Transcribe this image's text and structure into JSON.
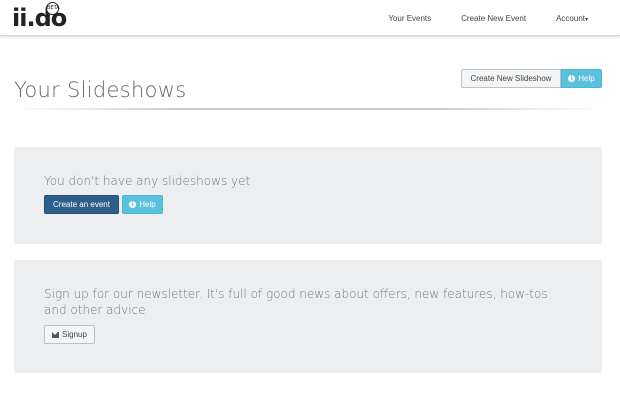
{
  "logo": {
    "text": "ii.do",
    "badge": "BETA"
  },
  "nav": {
    "your_events": "Your Events",
    "create_new_event": "Create New Event",
    "account": "Account",
    "account_caret": "▾"
  },
  "page": {
    "title": "Your Slideshows",
    "create_slideshow_label": "Create New Slideshow",
    "help_label": "Help"
  },
  "empty_panel": {
    "message": "You don't have any slideshows yet",
    "create_event_label": "Create an event",
    "help_label": "Help"
  },
  "newsletter_panel": {
    "message": "Sign up for our newsletter. It's full of good news about offers, new features, how-tos and other advice",
    "signup_label": "Signup"
  },
  "icons": {
    "info": "info-circle-icon",
    "envelope": "envelope-icon"
  },
  "colors": {
    "primary": "#2e5f8a",
    "info": "#5bc0de",
    "panel_bg": "#eceef0"
  }
}
